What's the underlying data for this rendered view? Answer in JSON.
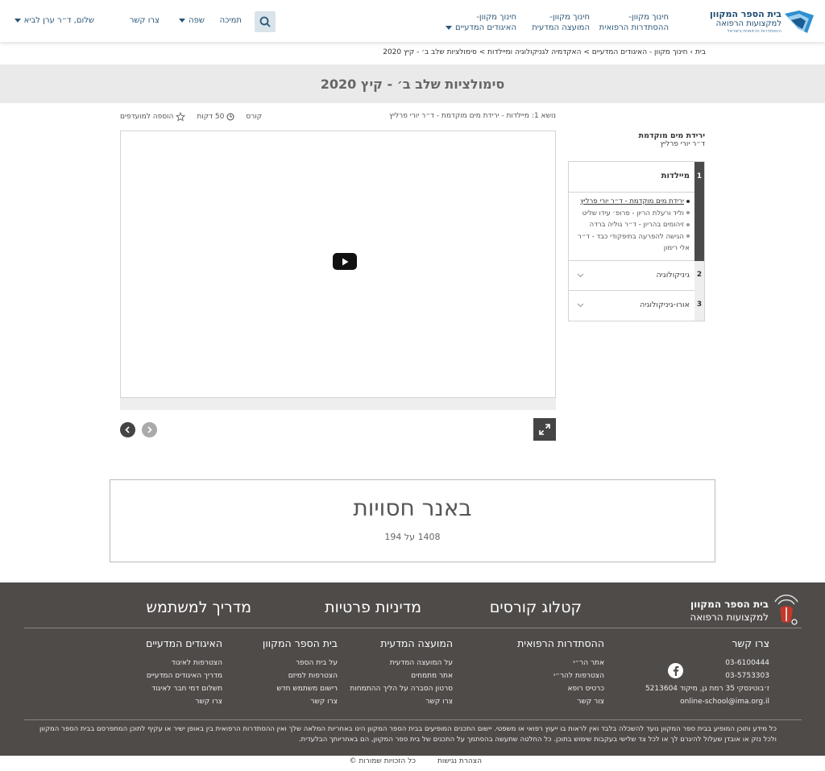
{
  "header": {
    "logo_title": "בית הספר המקוון",
    "logo_subtitle": "למקצועות הרפואה",
    "logo_tagline": "ההסתדרות הרפואית בישראל",
    "nav": [
      {
        "line1": "חינוך מקוון-",
        "line2": "ההסתדרות הרפואית"
      },
      {
        "line1": "חינוך מקוון-",
        "line2": "המועצה המדעית"
      },
      {
        "line1": "חינוך מקוון-",
        "line2": "האיגודים המדעיים"
      }
    ],
    "support": "תמיכה",
    "language": "שפה",
    "contact": "צרו קשר",
    "user_greeting": "שלום, ד״ר ערן לביא"
  },
  "breadcrumb": "בית › חינוך מקוון - האיגודים המדעיים > האקדמיה לגניקולוגיה ומיילדות > סימולציות שלב ב׳ - קיץ 2020",
  "page_title": "סימולציות שלב ב׳ - קיץ 2020",
  "topic_line": "נושא 1: מיילדות - ירידת מים מוקדמת - ד״ר יורי פרליץ",
  "meta": {
    "course": "קורס",
    "duration": "50 דקות",
    "favorites": "הוספה למועדפים"
  },
  "sidebar": {
    "current_lesson": "ירידת מים מוקדמת",
    "current_lecturer": "ד״ר יורי פרליץ",
    "sections": [
      {
        "number": "1",
        "title": "מיילדות",
        "expanded": true,
        "lessons": [
          "ירידת מים מוקדמת - ד״ר יורי פרליץ",
          "וליד ורעלת הריון - פרופ׳ עידו שליט",
          "זיהומים בהריון - ד״ר גוליה ברדה",
          "הגישה להפרעה בתיפקודי כבד - ד״ר אלי רימון"
        ]
      },
      {
        "number": "2",
        "title": "גיניקולוגיה",
        "expanded": false,
        "lessons": []
      },
      {
        "number": "3",
        "title": "אורו-גיניקולוגיה",
        "expanded": false,
        "lessons": []
      }
    ]
  },
  "banner": {
    "title": "באנר חסויות",
    "size": "1408 על 194"
  },
  "footer": {
    "big_links": [
      "קטלוג קורסים",
      "מדיניות פרטיות",
      "מדריך למשתמש"
    ],
    "logo_title": "בית הספר המקוון",
    "logo_subtitle": "למקצועות הרפואה",
    "contact": {
      "heading": "צרו קשר",
      "phone1": "03-6100444",
      "phone2": "03-5753303",
      "address": "ז׳בוטינסקי 35 רמת גן, מיקוד 5213604",
      "email": "online-school@ima.org.il"
    },
    "columns": [
      {
        "heading": "ההסתדרות הרפואית",
        "links": [
          "אתר הר״י",
          "הצטרפות להר״י",
          "כרטיס רופא",
          "צור קשר"
        ]
      },
      {
        "heading": "המועצה המדעית",
        "links": [
          "על המועצה המדעית",
          "אתר מתמחים",
          "סרטון הסברה על הליך ההתמחות",
          "צרו קשר"
        ]
      },
      {
        "heading": "בית הספר המקוון",
        "links": [
          "על בית הספר",
          "הצטרפות למיזם",
          "רישום משתמש חדש",
          "צרו קשר"
        ]
      },
      {
        "heading": "האיגודים המדעיים",
        "links": [
          "הצטרפות לאיגוד",
          "מדריך האיגודים המדעיים",
          "תשלום דמי חבר לאיגוד",
          "צרו קשר"
        ]
      }
    ],
    "disclaimer": "כל מידע ותוכן המופיע בבית ספר המקוון נועד להשכלה בלבד ואין לראות בו ייעוץ רפואי או משפטי. יישום התכנים המופיעים בבית הספר המקוון הינו באחריות המלאה שלך ואין ההסתדרות הרפואית בין באופן ישיר או עקיף לתוכן המתפרסם בבית הספר המקוון ולכל נזק או אובדן שעלול להיגרם לך או לכל צד שלישי בעקבות שימוש בתוכן. כל החלטה שתעשה בהסתמך על התכנים של בית ספר המקוון, הם באחריותך הבלעדית."
  },
  "bottom_bar": {
    "accessibility": "הצהרת נגישות",
    "copyright": "כל הזכויות שמורות"
  },
  "colors": {
    "brand_blue": "#2b5676",
    "footer_bg": "#4f4b49",
    "title_band": "#eaeaea",
    "accent_dark": "#4a4a4a"
  }
}
